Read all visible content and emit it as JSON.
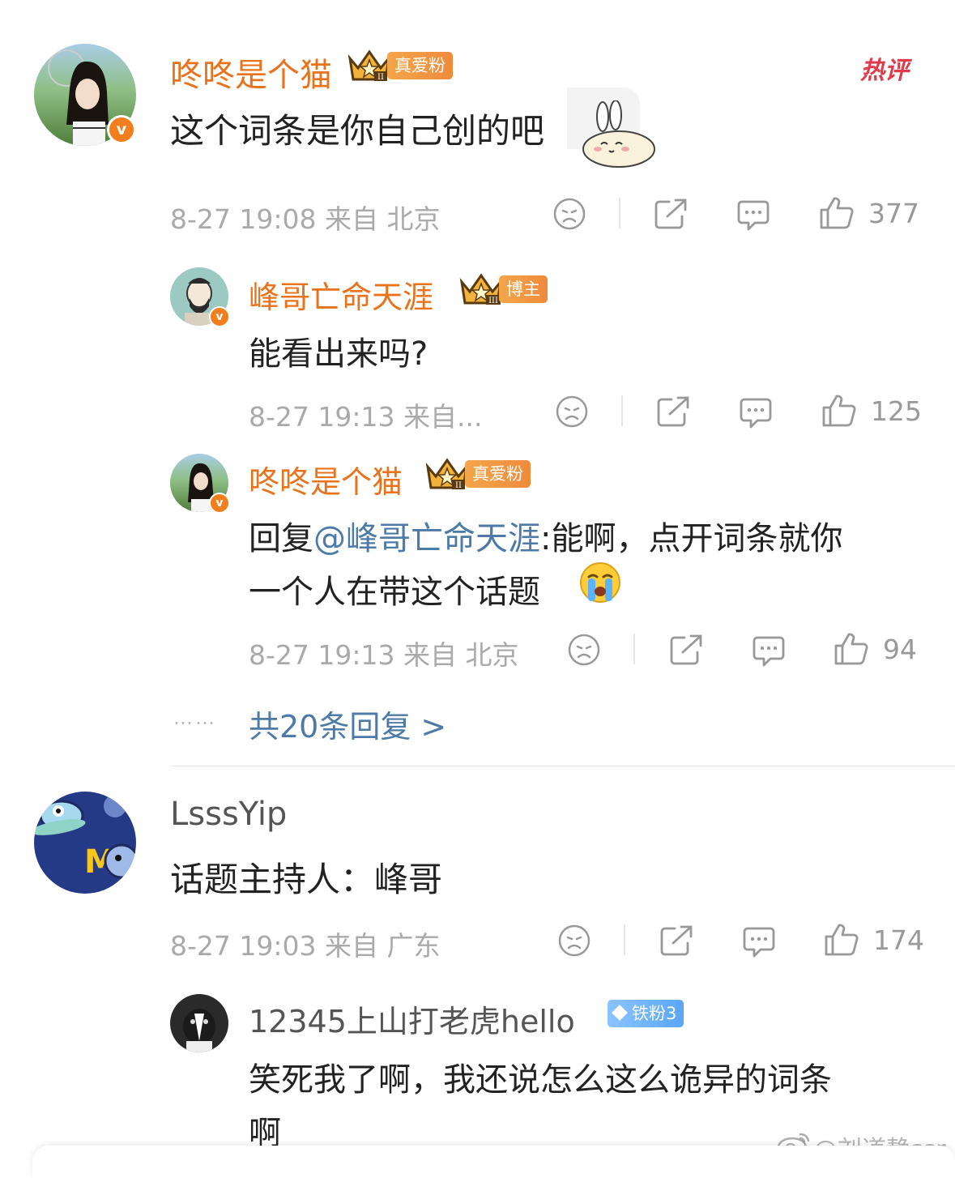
{
  "hot_label": "热评",
  "comments": [
    {
      "name": "咚咚是个猫",
      "badge_level": "II",
      "fan_badge": "真爱粉",
      "text": "这个词条是你自己创的吧",
      "meta": "8-27 19:08  来自 北京",
      "likes": "377",
      "replies": [
        {
          "name": "峰哥亡命天涯",
          "badge_level": "III",
          "fan_badge": "博主",
          "text": "能看出来吗?",
          "meta": "8-27 19:13  来自...",
          "likes": "125"
        },
        {
          "name": "咚咚是个猫",
          "badge_level": "II",
          "fan_badge": "真爱粉",
          "reply_prefix": "回复",
          "mention": "@峰哥亡命天涯",
          "text_line1": ":能啊，点开词条就你",
          "text_line2": "一个人在带这个话题",
          "meta": "8-27 19:13  来自 北京",
          "likes": "94"
        }
      ],
      "more_dots": "……",
      "more_replies": "共20条回复 >"
    },
    {
      "name": "LsssYip",
      "text": "话题主持人：峰哥",
      "meta": "8-27 19:03  来自 广东",
      "likes": "174",
      "replies": [
        {
          "name": "12345上山打老虎hello",
          "fan_badge": "铁粉3",
          "text_line1": "笑死我了啊，我还说怎么这么诡异的词条",
          "text_line2": "啊"
        }
      ]
    }
  ],
  "watermark": "@刘道静ssr",
  "colors": {
    "name_orange": "#e8731c",
    "link_blue": "#4d7aa7",
    "meta_gray": "#aaaaaa",
    "hot_red": "#e03b4a",
    "badge_orange": "#f08a3c",
    "badge_blue": "#5aa6f5"
  },
  "icons": [
    "dislike-face-icon",
    "share-icon",
    "comment-icon",
    "like-thumb-icon",
    "crown-icon",
    "verified-v-icon",
    "bunny-sticker-icon",
    "crying-emoji-icon",
    "diamond-icon",
    "weibo-logo-icon"
  ]
}
